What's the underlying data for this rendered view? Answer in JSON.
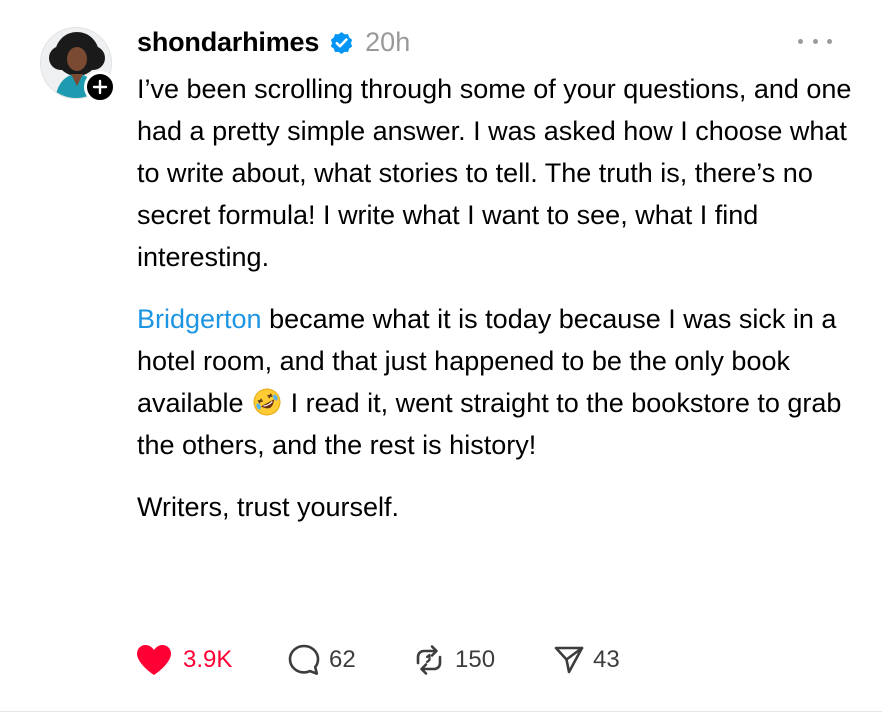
{
  "post": {
    "username": "shondarhimes",
    "timestamp": "20h",
    "paragraphs": [
      {
        "text": "I’ve been scrolling through some of your questions, and one had a pretty simple answer. I was asked how I choose what to write about, what stories to tell. The truth is, there’s no secret formula! I write what I want to see, what I find interesting."
      },
      {
        "mention": "Bridgerton",
        "text_before_emoji": " became what it is today because I was sick in a hotel room, and that just happened to be the only book available",
        "emoji": "rolling-on-the-floor-laughing-emoji",
        "text_after_emoji": " I read it, went straight to the bookstore to grab the others, and the rest is history!"
      },
      {
        "text": "Writers, trust yourself."
      }
    ]
  },
  "actions": {
    "likes": "3.9K",
    "replies": "62",
    "reposts": "150",
    "shares": "43"
  },
  "icons": {
    "verified": "verified-badge-icon",
    "follow": "plus-icon",
    "more": "more-options-icon",
    "like": "heart-icon",
    "reply": "speech-bubble-icon",
    "repost": "repost-icon",
    "share": "paper-plane-icon"
  },
  "colors": {
    "link": "#1d95e2",
    "liked": "#ff0034",
    "verified": "#0095f6",
    "muted": "#999999"
  }
}
